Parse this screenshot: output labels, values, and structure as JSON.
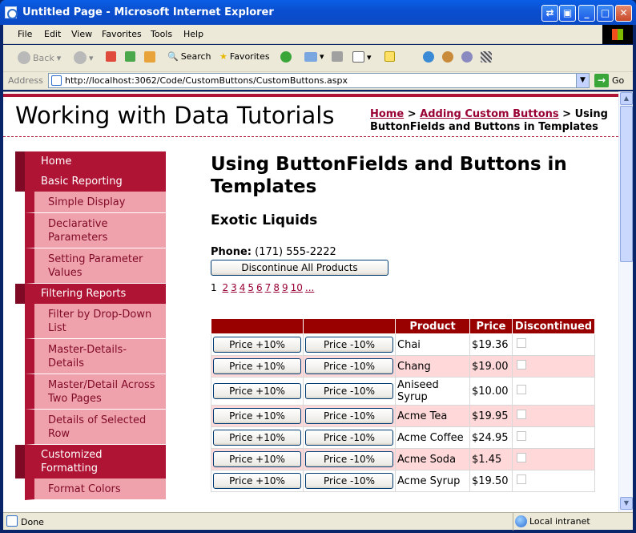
{
  "window": {
    "title": "Untitled Page - Microsoft Internet Explorer"
  },
  "menu": [
    "File",
    "Edit",
    "View",
    "Favorites",
    "Tools",
    "Help"
  ],
  "toolbar": {
    "back": "Back",
    "search": "Search",
    "favorites": "Favorites"
  },
  "address": {
    "label": "Address",
    "url": "http://localhost:3062/Code/CustomButtons/CustomButtons.aspx",
    "go": "Go"
  },
  "site": {
    "title": "Working with Data Tutorials"
  },
  "breadcrumb": {
    "home": "Home",
    "sep1": " > ",
    "parent": "Adding Custom Buttons",
    "sep2": " > ",
    "current": "Using ButtonFields and Buttons in Templates"
  },
  "nav": [
    {
      "type": "sec",
      "label": "Home"
    },
    {
      "type": "sec",
      "label": "Basic Reporting"
    },
    {
      "type": "sub",
      "label": "Simple Display"
    },
    {
      "type": "sub",
      "label": "Declarative Parameters"
    },
    {
      "type": "sub",
      "label": "Setting Parameter Values"
    },
    {
      "type": "sec",
      "label": "Filtering Reports"
    },
    {
      "type": "sub",
      "label": "Filter by Drop-Down List"
    },
    {
      "type": "sub",
      "label": "Master-Details-Details"
    },
    {
      "type": "sub",
      "label": "Master/Detail Across Two Pages"
    },
    {
      "type": "sub",
      "label": "Details of Selected Row"
    },
    {
      "type": "sec",
      "label": "Customized Formatting"
    },
    {
      "type": "sub",
      "label": "Format Colors"
    }
  ],
  "main": {
    "heading": "Using ButtonFields and Buttons in Templates",
    "supplier": "Exotic Liquids",
    "phone_label": "Phone:",
    "phone_value": "(171) 555-2222",
    "discontinue_all": "Discontinue All Products",
    "pager": {
      "current": "1",
      "pages": [
        "2",
        "3",
        "4",
        "5",
        "6",
        "7",
        "8",
        "9",
        "10",
        "..."
      ]
    }
  },
  "grid": {
    "headers": [
      "",
      "",
      "Product",
      "Price",
      "Discontinued"
    ],
    "price_up_label": "Price +10%",
    "price_down_label": "Price -10%",
    "rows": [
      {
        "product": "Chai",
        "price": "$19.36",
        "discontinued": false
      },
      {
        "product": "Chang",
        "price": "$19.00",
        "discontinued": false
      },
      {
        "product": "Aniseed Syrup",
        "price": "$10.00",
        "discontinued": false
      },
      {
        "product": "Acme Tea",
        "price": "$19.95",
        "discontinued": false
      },
      {
        "product": "Acme Coffee",
        "price": "$24.95",
        "discontinued": false
      },
      {
        "product": "Acme Soda",
        "price": "$1.45",
        "discontinued": false
      },
      {
        "product": "Acme Syrup",
        "price": "$19.50",
        "discontinued": false
      }
    ]
  },
  "status": {
    "text": "Done",
    "zone": "Local intranet"
  },
  "colors": {
    "accent": "#b01434",
    "header": "#990000",
    "alt_row": "#ffd9d9",
    "nav_sub": "#f0a2ac"
  }
}
